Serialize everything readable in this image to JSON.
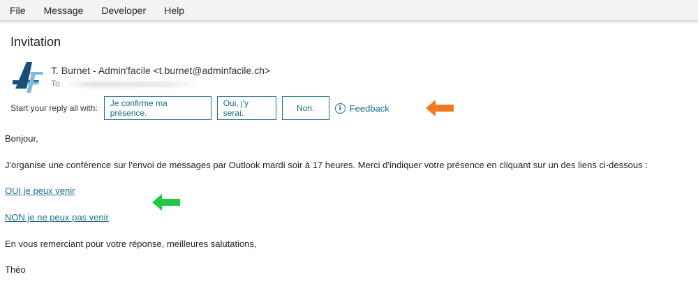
{
  "menubar": {
    "items": [
      "File",
      "Message",
      "Developer",
      "Help"
    ]
  },
  "email": {
    "subject": "Invitation",
    "sender": "T. Burnet - Admin'facile <t.burnet@adminfacile.ch>",
    "to_label": "To"
  },
  "reply": {
    "label": "Start your reply all with:",
    "options": [
      "Je confirme ma présence.",
      "Oui, j'y serai.",
      "Non."
    ],
    "feedback": "Feedback"
  },
  "message": {
    "greeting": "Bonjour,",
    "paragraph": "J'organise une conférence sur l'envoi de messages par Outlook mardi soir à 17 heures. Merci d'indiquer votre présence en cliquant sur un des liens ci-dessous :",
    "link_yes": "OUI je peux venir",
    "link_no": "NON je ne peux pas venir",
    "closing": "En vous remerciant pour votre réponse, meilleures salutations,",
    "signature": "Théo"
  },
  "colors": {
    "accent": "#1a6e8a",
    "orange_arrow": "#f07a20",
    "green_arrow": "#22c744",
    "logo_dark": "#1b4f7a",
    "logo_light": "#7fb8dd"
  }
}
